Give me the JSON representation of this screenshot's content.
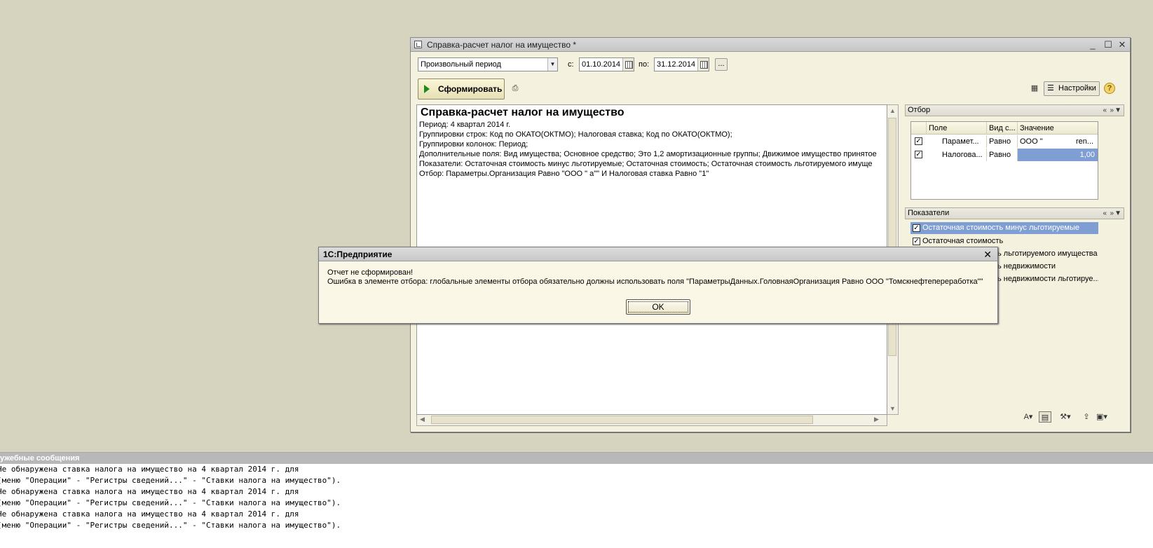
{
  "window": {
    "title": "Справка-расчет налог на имущество *",
    "minimize": "_",
    "maximize": "☐",
    "close": "✕"
  },
  "period": {
    "type": "Произвольный период",
    "from_label": "с:",
    "from": "01.10.2014",
    "to_label": "по:",
    "to": "31.12.2014",
    "more": "..."
  },
  "toolbar": {
    "generate": "Сформировать",
    "settings": "Настройки",
    "help": "?"
  },
  "report": {
    "title": "Справка-расчет налог на имущество",
    "lines": [
      "Период: 4 квартал 2014 г.",
      "Группировки строк: Код по ОКАТО(ОКТМО); Налоговая ставка; Код по ОКАТО(ОКТМО);",
      "Группировки колонок: Период;",
      "Дополнительные поля: Вид имущества; Основное средство; Это 1,2  амортизационные группы; Движимое имущество принятое",
      "Показатели: Остаточная стоимость минус льготируемые; Остаточная стоимость; Остаточная стоимость льготируемого имуще",
      "Отбор: Параметры.Организация Равно \"ООО \"                                   а\"\" И Налоговая ставка Равно \"1\""
    ]
  },
  "filter": {
    "title": "Отбор",
    "columns": [
      "Поле",
      "Вид с...",
      "Значение"
    ],
    "rows": [
      {
        "field": "Парамет...",
        "kind": "Равно",
        "value": "ООО \"",
        "value2": "ren..."
      },
      {
        "field": "Налогова...",
        "kind": "Равно",
        "value": "",
        "value2": "1,00"
      }
    ]
  },
  "indicators": {
    "title": "Показатели",
    "items": [
      "Остаточная стоимость минус льготируемые",
      "Остаточная стоимость",
      "ь льготируемого имущества",
      "ь недвижимости",
      "ь недвижимости льготируе..."
    ]
  },
  "dialog": {
    "title": "1С:Предприятие",
    "line1": "Отчет не сформирован!",
    "line2": "Ошибка в элементе отбора: глобальные элементы отбора обязательно должны использовать поля \"ПараметрыДанных.ГоловнаяОрганизация Равно ООО \"Томскнефтепереработка\"\"",
    "ok": "OK",
    "close": "✕"
  },
  "messages": {
    "title": "ужебные сообщения",
    "lines": [
      "Не обнаружена ставка налога на имущество на 4 квартал 2014 г. для",
      "(меню \"Операции\" - \"Регистры сведений...\" - \"Ставки налога на имущество\").",
      "Не обнаружена ставка налога на имущество на 4 квартал 2014 г. для",
      "(меню \"Операции\" - \"Регистры сведений...\" - \"Ставки налога на имущество\").",
      "Не обнаружена ставка налога на имущество на 4 квартал 2014 г. для",
      "(меню \"Операции\" - \"Регистры сведений...\" - \"Ставки налога на имущество\")."
    ]
  },
  "colors": {
    "background": "#d6d3bf",
    "selection": "#7e9ed4",
    "generate_arrow": "#1b8a1b"
  }
}
